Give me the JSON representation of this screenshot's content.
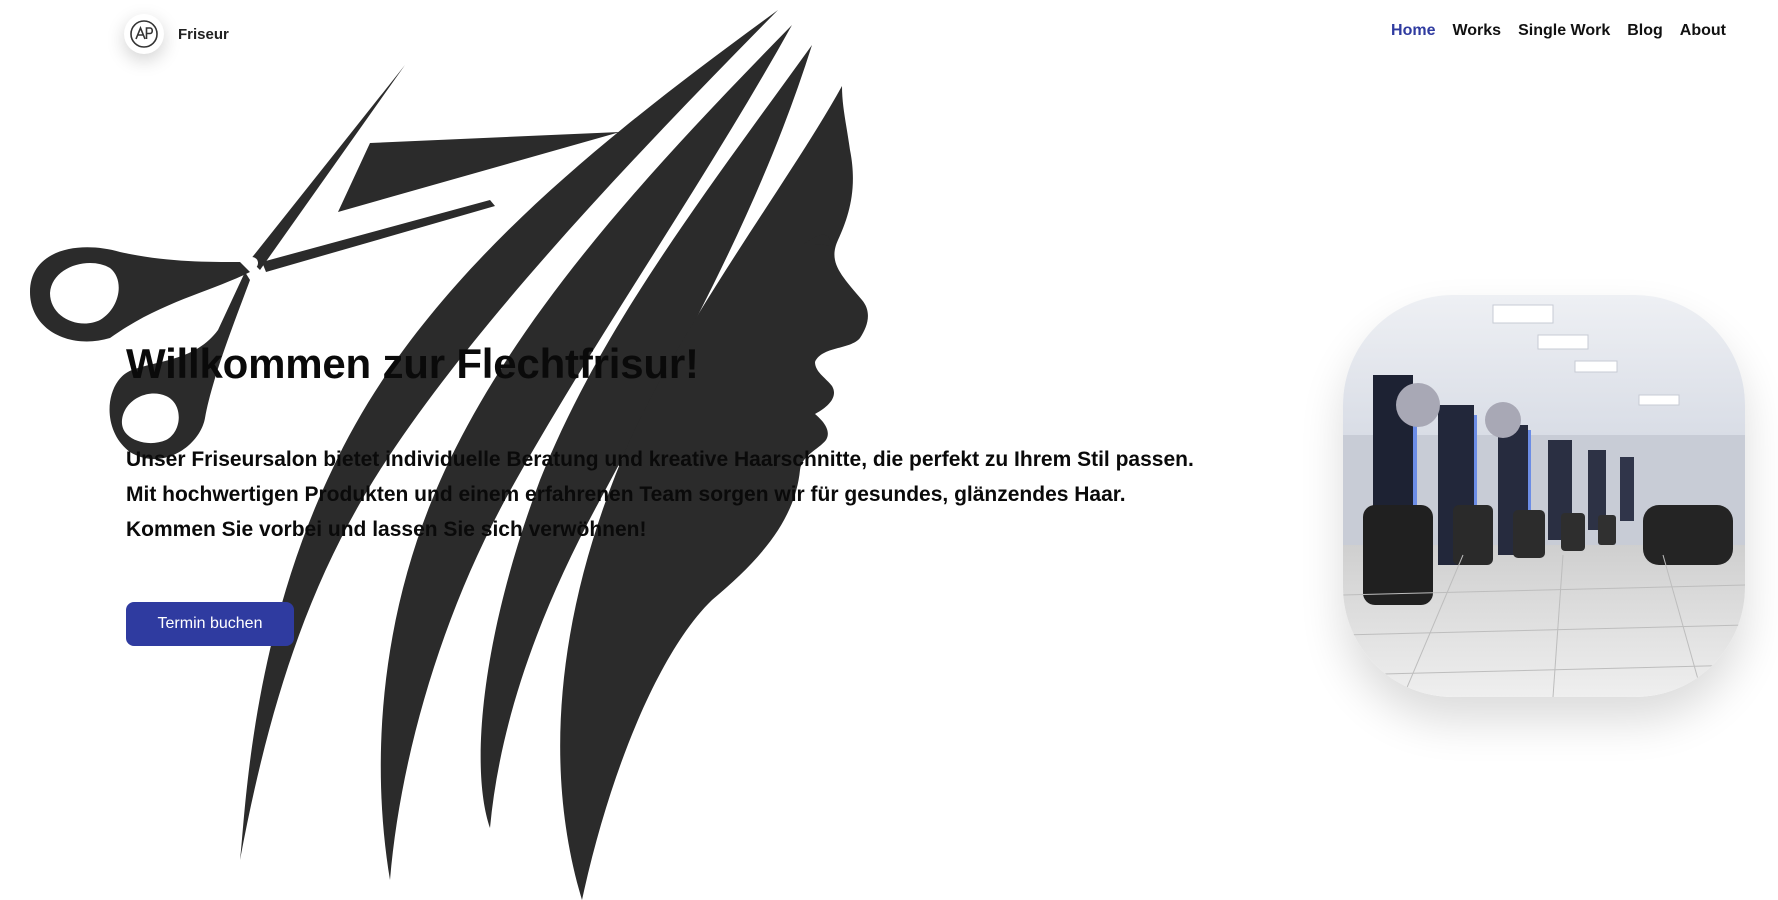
{
  "header": {
    "logo_text": "Friseur",
    "nav": [
      {
        "label": "Home",
        "active": true
      },
      {
        "label": "Works",
        "active": false
      },
      {
        "label": "Single Work",
        "active": false
      },
      {
        "label": "Blog",
        "active": false
      },
      {
        "label": "About",
        "active": false
      }
    ]
  },
  "hero": {
    "title": "Willkommen zur Flechtfrisur!",
    "description_lines": [
      "Unser Friseursalon bietet individuelle Beratung und kreative Haarschnitte, die perfekt zu Ihrem Stil passen.",
      "Mit hochwertigen Produkten und einem erfahrenen Team sorgen wir für gesundes, glänzendes Haar.",
      "Kommen Sie vorbei und lassen Sie sich verwöhnen!"
    ],
    "cta_label": "Termin buchen"
  },
  "colors": {
    "accent": "#2f3ba0",
    "silhouette": "#2b2b2b",
    "text": "#0a0a0a",
    "background": "#ffffff"
  },
  "icons": {
    "logo": "ap-logo-icon",
    "hero_illustration": "hair-scissors-silhouette",
    "salon_photo": "salon-interior-photo"
  }
}
